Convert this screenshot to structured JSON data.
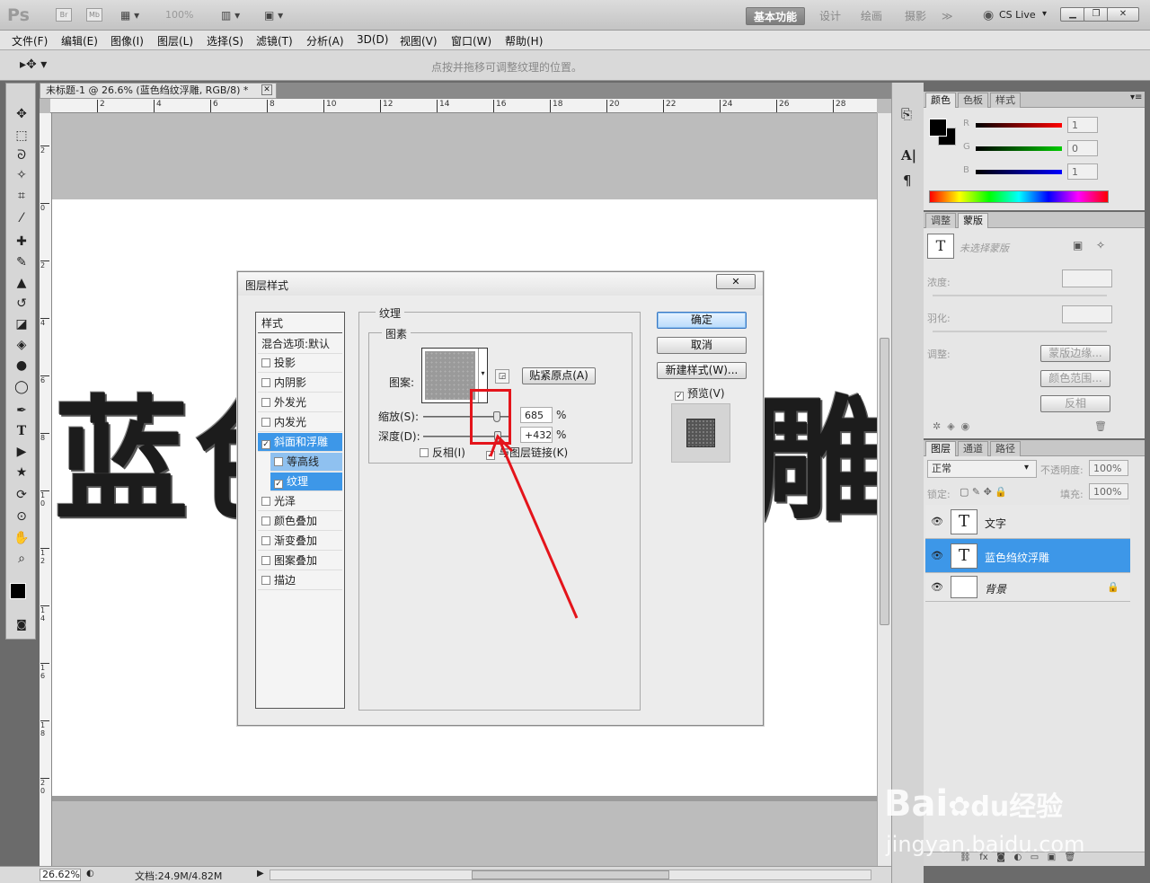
{
  "app": {
    "logo": "Ps",
    "br": "Br",
    "mb": "Mb",
    "zoom": "100%"
  },
  "workspaces": {
    "essentials": "基本功能",
    "design": "设计",
    "painting": "绘画",
    "photography": "摄影",
    "more": "≫",
    "cslive": "CS Live"
  },
  "menu": [
    "文件(F)",
    "编辑(E)",
    "图像(I)",
    "图层(L)",
    "选择(S)",
    "滤镜(T)",
    "分析(A)",
    "3D(D)",
    "视图(V)",
    "窗口(W)",
    "帮助(H)"
  ],
  "options": {
    "hint": "点按并拖移可调整纹理的位置。"
  },
  "document": {
    "tab": "未标题-1 @ 26.6% (蓝色绉纹浮雕, RGB/8) *",
    "text_left": "蓝色",
    "text_right": "雕",
    "ruler_top": [
      "2",
      "4",
      "6",
      "8",
      "10",
      "12",
      "14",
      "16",
      "18",
      "20",
      "22",
      "24",
      "26",
      "28"
    ],
    "ruler_left": [
      "2",
      "0",
      "2",
      "4",
      "6",
      "8",
      "1 0",
      "1 2",
      "1 4",
      "1 6",
      "1 8",
      "2 0"
    ]
  },
  "status": {
    "zoom": "26.62%",
    "doc": "文档:24.9M/4.82M"
  },
  "color_panel": {
    "tabs": [
      "颜色",
      "色板",
      "样式"
    ],
    "r_label": "R",
    "g_label": "G",
    "b_label": "B",
    "r": "1",
    "g": "0",
    "b": "1"
  },
  "mask_panel": {
    "tabs": [
      "调整",
      "蒙版"
    ],
    "none": "未选择蒙版",
    "density": "浓度:",
    "feather": "羽化:",
    "adjust": "调整:",
    "edge": "蒙版边缘...",
    "color_range": "颜色范围...",
    "invert": "反相"
  },
  "layers_panel": {
    "tabs": [
      "图层",
      "通道",
      "路径"
    ],
    "blend": "正常",
    "opacity_label": "不透明度:",
    "opacity": "100%",
    "lock_label": "锁定:",
    "fill_label": "填充:",
    "fill": "100%",
    "layers": [
      {
        "name": "文字",
        "thumb": "T"
      },
      {
        "name": "蓝色绉纹浮雕",
        "thumb": "T"
      },
      {
        "name": "背景",
        "thumb": ""
      }
    ]
  },
  "dialog": {
    "title": "图层样式",
    "styles_header": "样式",
    "blend_default": "混合选项:默认",
    "styles": [
      {
        "label": "投影",
        "checked": false
      },
      {
        "label": "内阴影",
        "checked": false
      },
      {
        "label": "外发光",
        "checked": false
      },
      {
        "label": "内发光",
        "checked": false
      },
      {
        "label": "斜面和浮雕",
        "checked": true
      },
      {
        "label": "等高线",
        "checked": false
      },
      {
        "label": "纹理",
        "checked": true
      },
      {
        "label": "光泽",
        "checked": false
      },
      {
        "label": "颜色叠加",
        "checked": false
      },
      {
        "label": "渐变叠加",
        "checked": false
      },
      {
        "label": "图案叠加",
        "checked": false
      },
      {
        "label": "描边",
        "checked": false
      }
    ],
    "section": "纹理",
    "group": "图素",
    "pattern_label": "图案:",
    "snap": "贴紧原点(A)",
    "scale_label": "缩放(S):",
    "scale": "685",
    "depth_label": "深度(D):",
    "depth": "+432",
    "pct": "%",
    "invert": "反相(I)",
    "link": "与图层链接(K)",
    "ok": "确定",
    "cancel": "取消",
    "new_style": "新建样式(W)...",
    "preview": "预览(V)",
    "scale_fraction": 0.85,
    "depth_fraction": 0.86
  },
  "watermark": {
    "brand": "Bai",
    "brand2": "经验",
    "url": "jingyan.baidu.com"
  }
}
